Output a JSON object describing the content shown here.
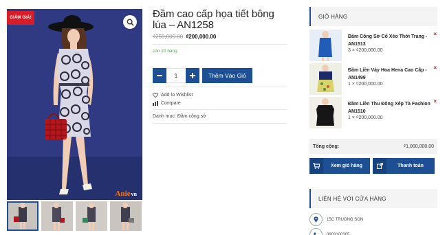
{
  "gallery": {
    "sale_badge": "GIẢM GIÁ!",
    "logo_text": "Anie",
    "logo_suffix": "vn"
  },
  "product": {
    "title": "Đầm cao cấp họa tiết bông lúa – AN1258",
    "price_old": "₫250,000.00",
    "price_new": "₫200,000.00",
    "stock": "còn 20 hàng",
    "quantity": "1",
    "add_to_cart_label": "Thêm Vào Giỏ",
    "wishlist_label": "Add to Wishlist",
    "compare_label": "Compare",
    "category_label": "Danh mục:",
    "category_value": "Đầm công sở"
  },
  "cart": {
    "title": "GIỎ HÀNG",
    "items": [
      {
        "name_line1": "Đầm Công Sở Cổ Xéo Thời Trang -",
        "name_line2": "AN1513",
        "qty_price": "3 × ₫200,000.00"
      },
      {
        "name_line1": "Đầm Liền Váy Hoa Hena Cao Cấp -",
        "name_line2": "AN1499",
        "qty_price": "1 × ₫200,000.00"
      },
      {
        "name_line1": "Đầm Liền Thu Đông Xếp Tà Fashion",
        "name_line2": "AN1510",
        "qty_price": "1 × ₫200,000.00"
      }
    ],
    "remove_symbol": "×",
    "total_label": "Tổng cộng:",
    "total_value": "₫1,000,000.00",
    "view_cart_label": "Xem giỏ hàng",
    "checkout_label": "Thanh toán"
  },
  "contact": {
    "title": "LIÊN HỆ VỚI CỬA HÀNG",
    "address": "15C TRUONG SON",
    "phone": "0903100305"
  },
  "colors": {
    "primary": "#1d4f95",
    "sale": "#d71e28",
    "stock": "#5aa34a"
  },
  "icons": [
    "search-icon",
    "minus-icon",
    "plus-icon",
    "heart-icon",
    "bar-chart-icon",
    "cart-icon",
    "external-link-icon",
    "map-pin-icon",
    "phone-icon",
    "close-icon"
  ]
}
